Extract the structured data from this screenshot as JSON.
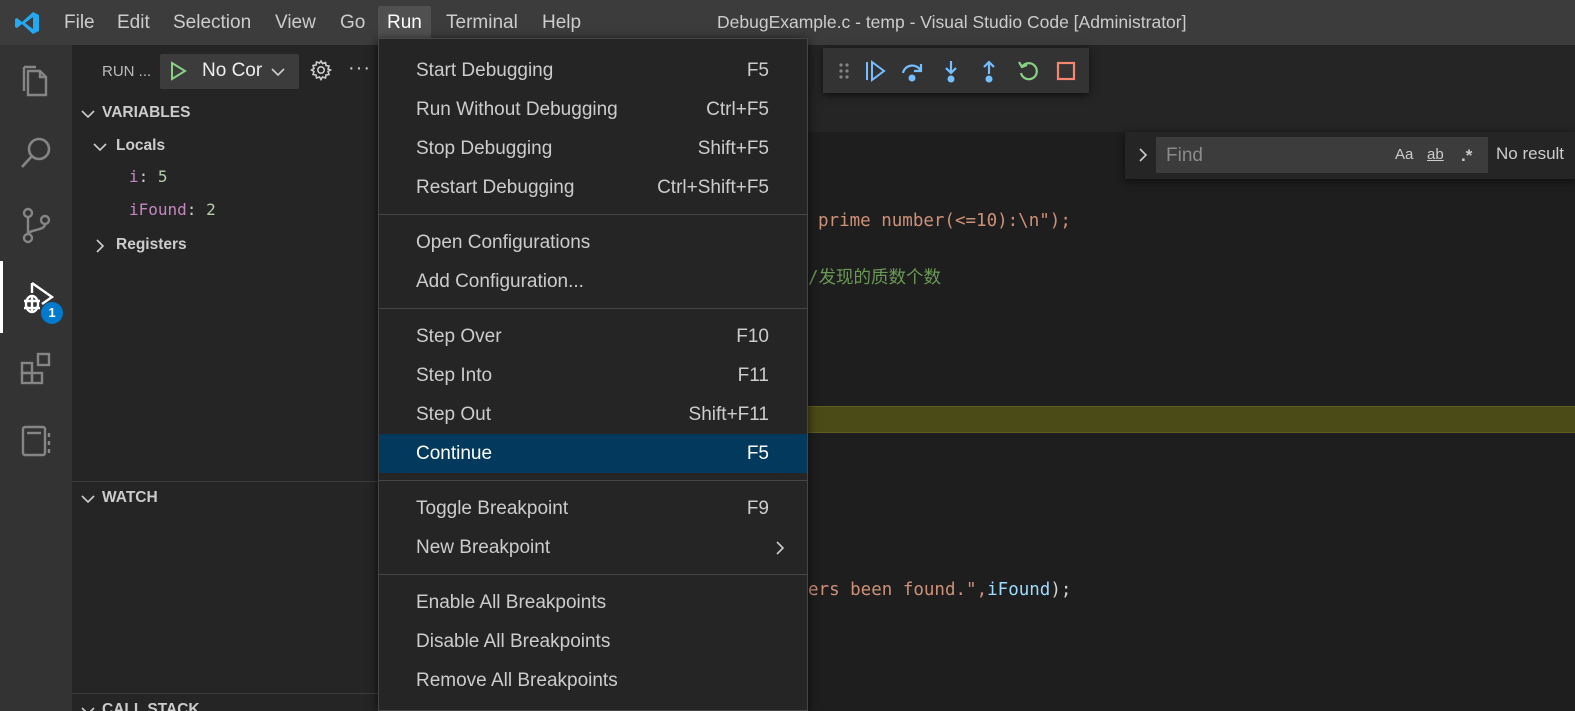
{
  "titlebar": {
    "window_title": "DebugExample.c - temp - Visual Studio Code [Administrator]",
    "menu": [
      "File",
      "Edit",
      "Selection",
      "View",
      "Go",
      "Run",
      "Terminal",
      "Help"
    ],
    "active_menu": "Run"
  },
  "activitybar": {
    "items": [
      "explorer-icon",
      "search-icon",
      "source-control-icon",
      "run-debug-icon",
      "extensions-icon",
      "notebook-icon"
    ],
    "debug_badge": "1"
  },
  "sidebar": {
    "run_title": "RUN ...",
    "config_label": "No Cor",
    "variables_header": "VARIABLES",
    "locals_label": "Locals",
    "variables": [
      {
        "name": "i",
        "value": "5"
      },
      {
        "name": "iFound",
        "value": "2"
      }
    ],
    "registers_label": "Registers",
    "watch_header": "WATCH",
    "callstack_header": "CALL STACK"
  },
  "find": {
    "placeholder": "Find",
    "match_case": "Aa",
    "whole_word": "ab",
    "regex": ".*",
    "result": "No result"
  },
  "code": {
    "line1": "prime number(<=10):\\n\");",
    "line2_comment": "/发现的质数个数",
    "line3_string": "ers been found.\",",
    "line3_var": "iFound",
    "line3_end": ");"
  },
  "run_menu": {
    "groups": [
      [
        {
          "label": "Start Debugging",
          "key": "F5"
        },
        {
          "label": "Run Without Debugging",
          "key": "Ctrl+F5"
        },
        {
          "label": "Stop Debugging",
          "key": "Shift+F5"
        },
        {
          "label": "Restart Debugging",
          "key": "Ctrl+Shift+F5"
        }
      ],
      [
        {
          "label": "Open Configurations",
          "key": ""
        },
        {
          "label": "Add Configuration...",
          "key": ""
        }
      ],
      [
        {
          "label": "Step Over",
          "key": "F10"
        },
        {
          "label": "Step Into",
          "key": "F11"
        },
        {
          "label": "Step Out",
          "key": "Shift+F11"
        },
        {
          "label": "Continue",
          "key": "F5"
        }
      ],
      [
        {
          "label": "Toggle Breakpoint",
          "key": "F9"
        },
        {
          "label": "New Breakpoint",
          "key": ""
        }
      ],
      [
        {
          "label": "Enable All Breakpoints",
          "key": ""
        },
        {
          "label": "Disable All Breakpoints",
          "key": ""
        },
        {
          "label": "Remove All Breakpoints",
          "key": ""
        }
      ]
    ],
    "selected_label": "Continue"
  },
  "colors": {
    "accent": "#007acc",
    "menu_selection": "#04395e",
    "current_line_highlight": "#4b4b18",
    "debug_blue": "#75beff",
    "debug_green": "#89d185",
    "debug_stop": "#f48771"
  }
}
